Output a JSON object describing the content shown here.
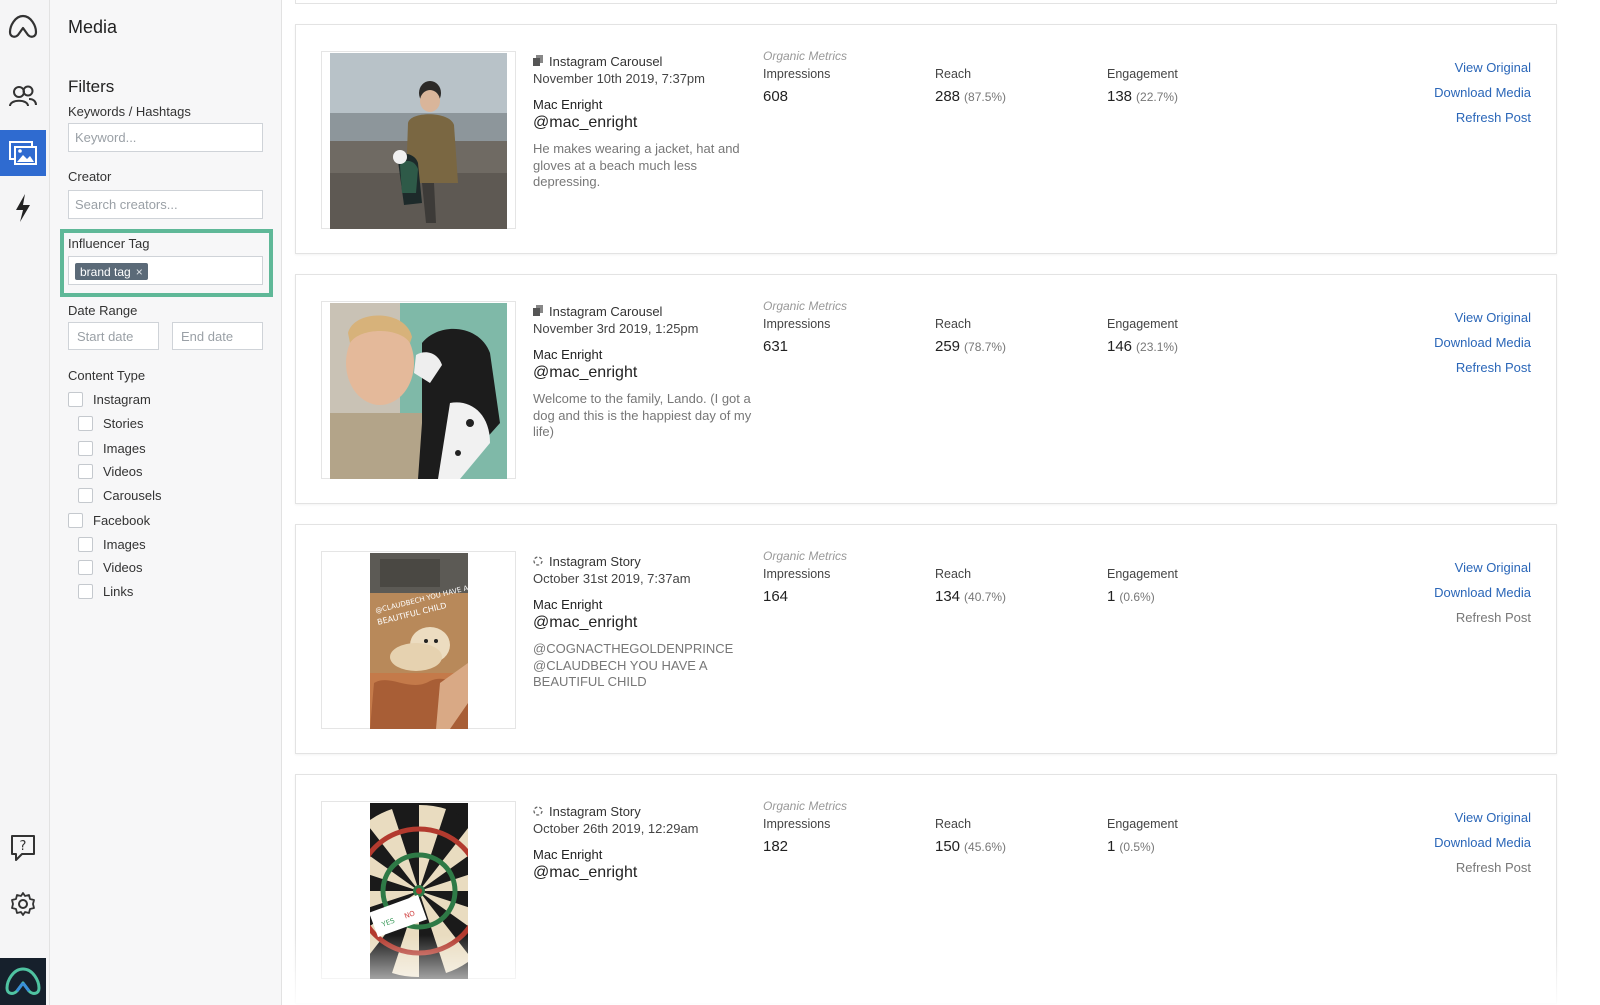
{
  "nav": {
    "items": [
      {
        "icon": "logo-icon"
      },
      {
        "icon": "creators-icon"
      },
      {
        "icon": "media-icon",
        "active": true
      },
      {
        "icon": "lightning-icon"
      }
    ],
    "bottom": [
      {
        "icon": "help-icon"
      },
      {
        "icon": "gear-icon"
      },
      {
        "icon": "brand-logo-icon"
      }
    ]
  },
  "sidebar": {
    "title": "Media",
    "filters_heading": "Filters",
    "keywords": {
      "label": "Keywords / Hashtags",
      "placeholder": "Keyword..."
    },
    "creator": {
      "label": "Creator",
      "placeholder": "Search creators..."
    },
    "influencer_tag": {
      "label": "Influencer Tag",
      "chip": "brand tag",
      "chip_remove": "×"
    },
    "date_range": {
      "label": "Date Range",
      "start_placeholder": "Start date",
      "end_placeholder": "End date"
    },
    "content_type": {
      "label": "Content Type",
      "instagram": {
        "label": "Instagram",
        "children": [
          "Stories",
          "Images",
          "Videos",
          "Carousels"
        ]
      },
      "facebook": {
        "label": "Facebook",
        "children": [
          "Images",
          "Videos",
          "Links"
        ]
      }
    }
  },
  "metrics_labels": {
    "section": "Organic Metrics",
    "impressions": "Impressions",
    "reach": "Reach",
    "engagement": "Engagement"
  },
  "action_labels": {
    "view_original": "View Original",
    "download_media": "Download Media",
    "refresh_post": "Refresh Post"
  },
  "colors": {
    "accent": "#2f6bd0",
    "link": "#2a66b8",
    "highlight": "#5fb898"
  },
  "posts": [
    {
      "type": "Instagram Carousel",
      "type_icon": "carousel-icon",
      "date": "November 10th 2019, 7:37pm",
      "creator": "Mac Enright",
      "handle": "@mac_enright",
      "caption": "He makes wearing a jacket, hat and gloves at a beach much less depressing.",
      "impressions": "608",
      "reach": "288",
      "reach_pct": "(87.5%)",
      "engagement": "138",
      "engagement_pct": "(22.7%)",
      "refresh_enabled": true
    },
    {
      "type": "Instagram Carousel",
      "type_icon": "carousel-icon",
      "date": "November 3rd 2019, 1:25pm",
      "creator": "Mac Enright",
      "handle": "@mac_enright",
      "caption": "Welcome to the family, Lando. (I got a dog and this is the happiest day of my life)",
      "impressions": "631",
      "reach": "259",
      "reach_pct": "(78.7%)",
      "engagement": "146",
      "engagement_pct": "(23.1%)",
      "refresh_enabled": true
    },
    {
      "type": "Instagram Story",
      "type_icon": "story-icon",
      "date": "October 31st 2019, 7:37am",
      "creator": "Mac Enright",
      "handle": "@mac_enright",
      "caption": "@COGNACTHEGOLDENPRINCE @CLAUDBECH YOU HAVE A BEAUTIFUL CHILD",
      "impressions": "164",
      "reach": "134",
      "reach_pct": "(40.7%)",
      "engagement": "1",
      "engagement_pct": "(0.6%)",
      "refresh_enabled": false
    },
    {
      "type": "Instagram Story",
      "type_icon": "story-icon",
      "date": "October 26th 2019, 12:29am",
      "creator": "Mac Enright",
      "handle": "@mac_enright",
      "caption": "",
      "impressions": "182",
      "reach": "150",
      "reach_pct": "(45.6%)",
      "engagement": "1",
      "engagement_pct": "(0.5%)",
      "refresh_enabled": false
    }
  ]
}
